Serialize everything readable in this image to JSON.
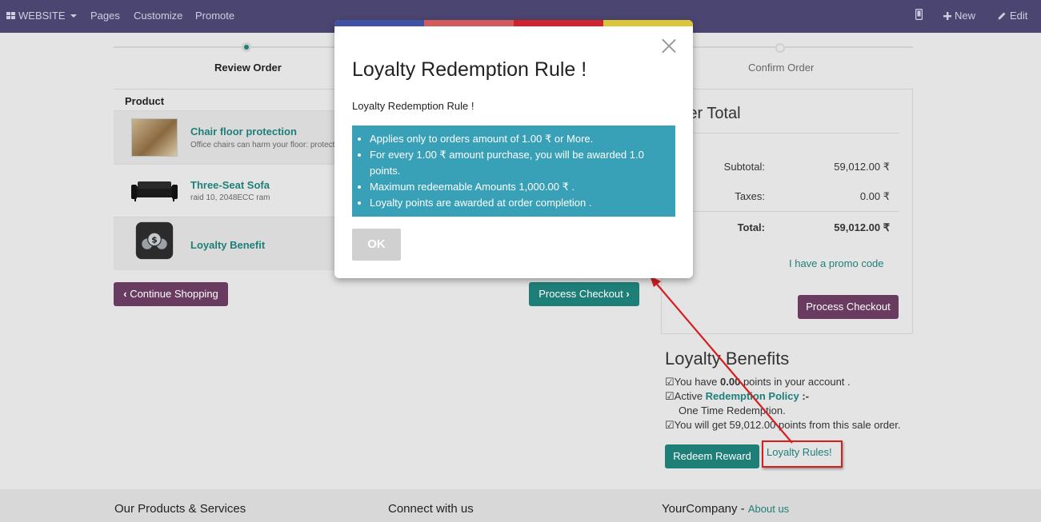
{
  "topbar": {
    "brand": "WEBSITE",
    "menu": [
      "Pages",
      "Customize",
      "Promote"
    ],
    "new_label": "New",
    "edit_label": "Edit"
  },
  "steps": {
    "step1": "Review Order",
    "step3": "Confirm Order"
  },
  "products": {
    "header": "Product",
    "items": [
      {
        "name": "Chair floor protection",
        "desc": "Office chairs can harm your floor: protect"
      },
      {
        "name": "Three-Seat Sofa",
        "desc": "raid 10, 2048ECC ram"
      },
      {
        "name": "Loyalty Benefit",
        "desc": ""
      }
    ]
  },
  "buttons": {
    "continue": "Continue Shopping",
    "process_left": "Process Checkout",
    "process_right": "Process Checkout",
    "redeem": "Redeem Reward"
  },
  "order_total": {
    "title": "Order Total",
    "subtotal_label": "Subtotal:",
    "subtotal_value": "59,012.00 ₹",
    "taxes_label": "Taxes:",
    "taxes_value": "0.00 ₹",
    "total_label": "Total:",
    "total_value": "59,012.00 ₹",
    "promo": "I have a promo code"
  },
  "loyalty": {
    "title": "Loyalty Benefits",
    "points_prefix": "☑You have ",
    "points_value": "0.00",
    "points_suffix": " points in your account .",
    "active_prefix": "☑Active ",
    "policy_link": "Redemption Policy",
    "policy_suffix": " :-",
    "policy_detail": "One Time Redemption.",
    "earn_line": "☑You will get 59,012.00 points from this sale order.",
    "rules_link": "Loyalty Rules!"
  },
  "footer": {
    "col1": "Our Products & Services",
    "col2": "Connect with us",
    "col3": "YourCompany",
    "col3_sep": " - ",
    "about": "About us"
  },
  "modal": {
    "title": "Loyalty Redemption Rule !",
    "subtitle": "Loyalty Redemption Rule !",
    "rules": [
      "Applies only to orders amount of 1.00 ₹ or More.",
      "For every 1.00 ₹ amount purchase, you will be awarded 1.0 points.",
      "Maximum redeemable Amounts 1,000.00 ₹ .",
      "Loyalty points are awarded at order completion ."
    ],
    "ok_label": "OK",
    "bar_colors": [
      "#3f51a5",
      "#d25c5c",
      "#d0232f",
      "#d9c63b"
    ]
  },
  "colors": {
    "navbar": "#4b4671",
    "accent": "#1e7f78",
    "purple_button": "#6a3b60",
    "info_box": "#38a1b7",
    "annotation_red": "#d41f1f"
  }
}
